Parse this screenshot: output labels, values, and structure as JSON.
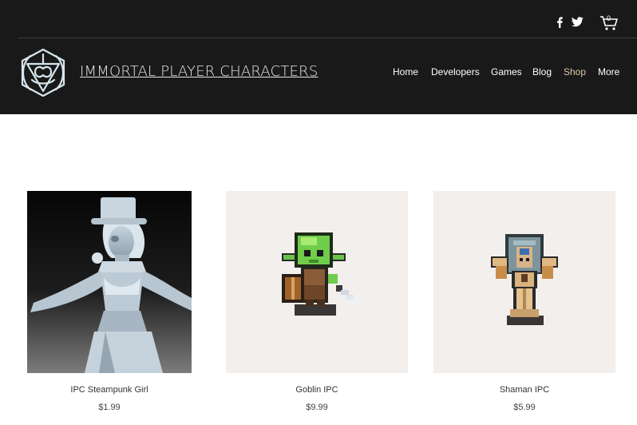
{
  "site": {
    "brand": "IMMORTAL PLAYER CHARACTERS",
    "cart_count": "0"
  },
  "nav": {
    "items": [
      {
        "label": "Home"
      },
      {
        "label": "Developers"
      },
      {
        "label": "Games"
      },
      {
        "label": "Blog"
      },
      {
        "label": "Shop",
        "active": true
      },
      {
        "label": "More"
      }
    ]
  },
  "social": [
    "facebook-icon",
    "twitter-icon",
    "cart-icon"
  ],
  "colors": {
    "header_bg": "#191919",
    "nav_active": "#d9c9a4",
    "thumb_bg": "#f3efed"
  },
  "products": [
    {
      "name": "IPC Steampunk Girl",
      "price": "$1.99"
    },
    {
      "name": "Goblin IPC",
      "price": "$9.99"
    },
    {
      "name": "Shaman IPC",
      "price": "$5.99"
    }
  ]
}
